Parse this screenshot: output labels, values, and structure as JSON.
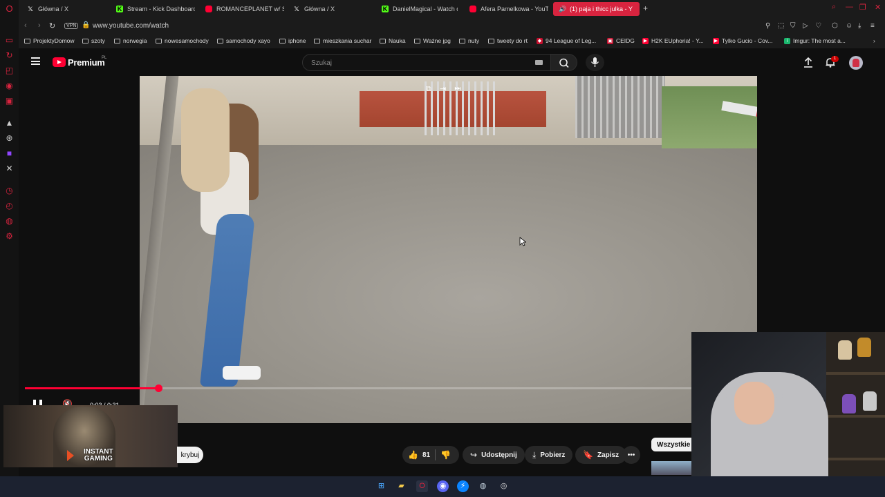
{
  "browser": {
    "tabs": [
      {
        "title": "Główna / X",
        "icon": "x-logo-icon"
      },
      {
        "title": "Stream - Kick Dashboard",
        "icon": "kick-logo-icon"
      },
      {
        "title": "ROMANCEPLANET w/ ST",
        "icon": "youtube-logo-icon"
      },
      {
        "title": "Główna / X",
        "icon": "x-logo-icon"
      },
      {
        "title": "DanielMagical - Watch ct",
        "icon": "kick-logo-icon"
      },
      {
        "title": "Afera Pamelkowa - YouTu",
        "icon": "youtube-logo-icon"
      },
      {
        "title": "(1) paja i thicc julka - Y",
        "icon": "speaker-icon",
        "active": true
      }
    ],
    "vpn_label": "VPN",
    "url": "www.youtube.com/watch",
    "bookmarks": [
      {
        "label": "ProjektyDomow",
        "type": "folder"
      },
      {
        "label": "szoty",
        "type": "folder"
      },
      {
        "label": "norwegia",
        "type": "folder"
      },
      {
        "label": "nowesamochody",
        "type": "folder"
      },
      {
        "label": "samochody xayo",
        "type": "folder"
      },
      {
        "label": "iphone",
        "type": "folder"
      },
      {
        "label": "mieszkania suchar",
        "type": "folder"
      },
      {
        "label": "Nauka",
        "type": "folder"
      },
      {
        "label": "Ważne jpg",
        "type": "folder"
      },
      {
        "label": "nuty",
        "type": "folder"
      },
      {
        "label": "tweety do rt",
        "type": "folder"
      },
      {
        "label": "94 League of Leg...",
        "type": "site"
      },
      {
        "label": "CEIDG",
        "type": "site"
      },
      {
        "label": "H2K EUphoria! - Y...",
        "type": "site"
      },
      {
        "label": "Tylko Gucio - Cov...",
        "type": "site"
      },
      {
        "label": "Imgur: The most a...",
        "type": "site"
      }
    ]
  },
  "youtube": {
    "brand": "Premium",
    "country": "PL",
    "search_placeholder": "Szukaj",
    "notification_count": "1",
    "player": {
      "time": "0:03 / 0:31",
      "progress": 0.2
    },
    "actions": {
      "likes": "81",
      "share": "Udostępnij",
      "download": "Pobierz",
      "save": "Zapisz"
    },
    "chip_all": "Wszystkie",
    "hide_button": "krybuj"
  },
  "ad": {
    "brand_line1": "INSTANT",
    "brand_line2": "GAMING"
  },
  "colors": {
    "accent_red": "#d8243f",
    "youtube_red": "#ff0033",
    "kick_green": "#53fc18"
  }
}
